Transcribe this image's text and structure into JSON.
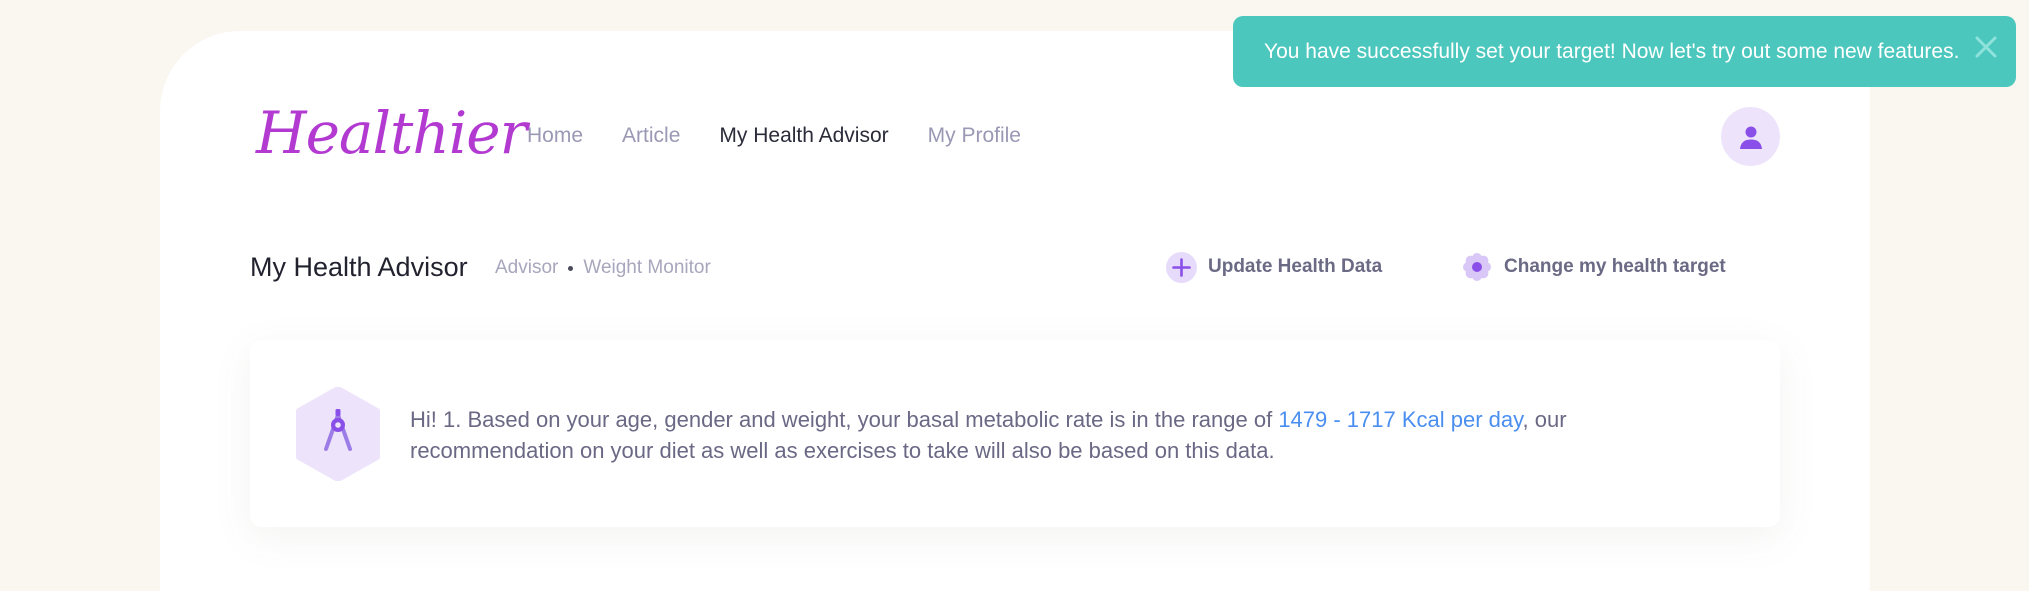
{
  "brand": {
    "logo_text": "Healthier"
  },
  "nav": {
    "items": [
      {
        "label": "Home",
        "active": false
      },
      {
        "label": "Article",
        "active": false
      },
      {
        "label": "My Health Advisor",
        "active": true
      },
      {
        "label": "My Profile",
        "active": false
      }
    ]
  },
  "toast": {
    "message": "You have successfully set your target! Now let's try out some new features."
  },
  "page": {
    "title": "My Health Advisor",
    "breadcrumb": [
      "Advisor",
      "Weight Monitor"
    ]
  },
  "actions": {
    "update_label": "Update Health Data",
    "target_label": "Change my health target"
  },
  "advisor": {
    "message_prefix": "Hi! 1. Based on your age, gender and weight, your basal metabolic rate is in the range of ",
    "highlight": "1479 - 1717 Kcal per day",
    "message_suffix": ", our recommendation on your diet as well as exercises to take will also be based on this data."
  },
  "colors": {
    "accent_purple": "#8a4fe8",
    "toast_bg": "#4cc7bd",
    "highlight_blue": "#4a8ef0",
    "logo_magenta": "#b23ad1"
  },
  "icons": {
    "avatar": "user-icon",
    "update": "plus-icon",
    "target": "flower-icon",
    "advisor": "compass-icon",
    "toast_close": "close-icon"
  }
}
